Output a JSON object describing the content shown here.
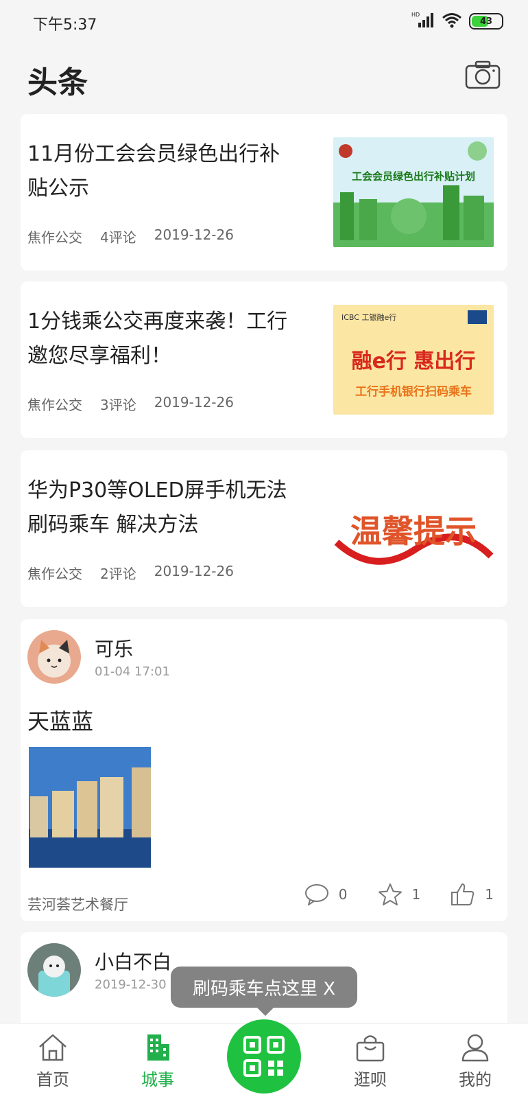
{
  "status": {
    "time": "下午5:37",
    "network_label": "HD",
    "battery": "43"
  },
  "header": {
    "title": "头条"
  },
  "news": [
    {
      "title": "11月份工会会员绿色出行补贴公示",
      "source": "焦作公交",
      "comments": "4评论",
      "date": "2019-12-26",
      "thumb_caption": "工会会员绿色出行补贴计划"
    },
    {
      "title": "1分钱乘公交再度来袭！工行邀您尽享福利！",
      "source": "焦作公交",
      "comments": "3评论",
      "date": "2019-12-26",
      "thumb_brand": "ICBC 工银融e行",
      "thumb_caption": "融e行 惠出行",
      "thumb_sub": "工行手机银行扫码乘车"
    },
    {
      "title": "华为P30等OLED屏手机无法刷码乘车 解决方法",
      "source": "焦作公交",
      "comments": "2评论",
      "date": "2019-12-26",
      "thumb_caption": "温馨提示"
    }
  ],
  "posts": [
    {
      "user": "可乐",
      "time": "01-04 17:01",
      "text": "天蓝蓝",
      "place": "芸河荟艺术餐厅",
      "comments": "0",
      "favorites": "1",
      "likes": "1"
    },
    {
      "user": "小白不白",
      "time": "2019-12-30"
    }
  ],
  "tooltip": "刷码乘车点这里 X",
  "tabs": [
    {
      "label": "首页"
    },
    {
      "label": "城事"
    },
    {
      "label": "逛呗"
    },
    {
      "label": "我的"
    }
  ],
  "colors": {
    "accent": "#21b04b",
    "scan_button": "#1ec240"
  }
}
